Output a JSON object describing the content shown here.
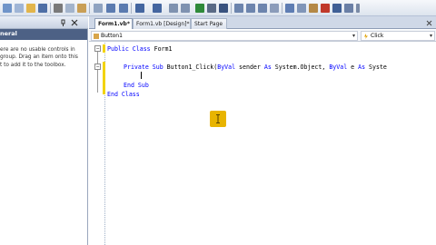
{
  "toolbox": {
    "group_label": "neral",
    "message_lines": [
      "ere are no usable controls in",
      "group. Drag an item onto this",
      "t to add it to the toolbox."
    ]
  },
  "tabs": [
    {
      "label": "Form1.vb*",
      "active": true
    },
    {
      "label": "Form1.vb [Design]*",
      "active": false
    },
    {
      "label": "Start Page",
      "active": false
    }
  ],
  "nav": {
    "left_value": "Button1",
    "right_value": "Click",
    "arrow": "▾"
  },
  "code": {
    "line1_kw1": "Public Class",
    "line1_rest": " Form1",
    "line2_kw1": "Private Sub",
    "line2_name": " Button1_Click(",
    "line2_kw2": "ByVal",
    "line2_mid": " sender ",
    "line2_kw3": "As",
    "line2_type": " System.Object, ",
    "line2_kw4": "ByVal",
    "line2_e": " e ",
    "line2_kw5": "As",
    "line2_tail": " Syste",
    "line4_kw": "End Sub",
    "line5_kw": "End Class",
    "collapse_symbol": "−"
  },
  "colors": {
    "keyword": "#0000ff",
    "accent": "#e8b400",
    "toolbox_header": "#4d6185"
  },
  "icons": {
    "cursor": "ibeam-cursor-icon",
    "class_combo": "class-icon",
    "method_combo": "event-method-icon"
  }
}
